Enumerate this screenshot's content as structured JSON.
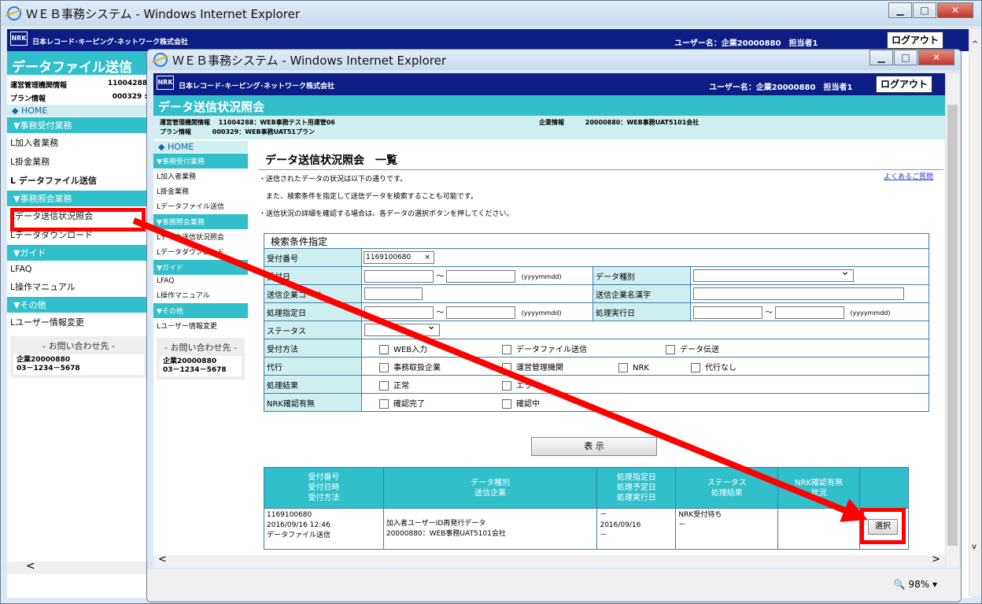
{
  "back_window": {
    "title": "ＷＥＢ事務システム - Windows Internet Explorer",
    "corp": "日本レコード･キーピング･ネットワーク株式会社",
    "user": "ユーザー名：企業20000880　担当者1",
    "logout": "ログアウト",
    "page_title": "データファイル送信",
    "info": [
      {
        "label": "運営管理機関情報",
        "value": "11004288"
      },
      {
        "label": "プラン情報",
        "value": "000329 :"
      }
    ],
    "home": "HOME",
    "nav": [
      {
        "type": "sec",
        "label": "▼事務受付業務"
      },
      {
        "type": "item",
        "label": "L加入者業務"
      },
      {
        "type": "item",
        "label": "L掛金業務"
      },
      {
        "type": "item",
        "label": "L データファイル送信"
      },
      {
        "type": "sec",
        "label": "▼事務照会業務"
      },
      {
        "type": "item",
        "label": "Lデータ送信状況照会"
      },
      {
        "type": "item",
        "label": "Lデータダウンロード"
      },
      {
        "type": "sec",
        "label": "▼ガイド"
      },
      {
        "type": "item",
        "label": "LFAQ"
      },
      {
        "type": "item",
        "label": "L操作マニュアル"
      },
      {
        "type": "sec",
        "label": "▼その他"
      },
      {
        "type": "item",
        "label": "Lユーザー情報変更"
      }
    ],
    "contact_title": "- お問い合わせ先 -",
    "contact_name": "企業20000880",
    "contact_tel": "03－1234－5678"
  },
  "front_window": {
    "title": "ＷＥＢ事務システム - Windows Internet Explorer",
    "corp": "日本レコード･キーピング･ネットワーク株式会社",
    "user": "ユーザー名：企業20000880　担当者1",
    "logout": "ログアウト",
    "page_title": "データ送信状況照会",
    "info": {
      "admin_label": "運営管理機関情報",
      "admin_value": "11004288：WEB事務テスト用運管06",
      "plan_label": "プラン情報",
      "plan_value": "000329：WEB事務UAT51プラン",
      "company_label": "企業情報",
      "company_value": "20000880：WEB事務UAT5101会社"
    },
    "nav": {
      "home": "HOME",
      "items": [
        {
          "type": "sec",
          "label": "▼事務受付業務"
        },
        {
          "type": "item",
          "label": "L加入者業務"
        },
        {
          "type": "item",
          "label": "L掛金業務"
        },
        {
          "type": "item",
          "label": "Lデータファイル送信"
        },
        {
          "type": "sec",
          "label": "▼事務照会業務"
        },
        {
          "type": "item",
          "label": "Lデータ送信状況照会"
        },
        {
          "type": "item",
          "label": "Lデータダウンロード"
        },
        {
          "type": "sec",
          "label": "▼ガイド"
        },
        {
          "type": "item",
          "label": "LFAQ"
        },
        {
          "type": "item",
          "label": "L操作マニュアル"
        },
        {
          "type": "sec",
          "label": "▼その他"
        },
        {
          "type": "item",
          "label": "Lユーザー情報変更"
        }
      ],
      "contact_title": "- お問い合わせ先 -",
      "contact_name": "企業20000880",
      "contact_tel": "03－1234－5678"
    },
    "main": {
      "heading": "データ送信状況照会　一覧",
      "faq_link": "よくあるご質問",
      "notes": [
        "・送信されたデータの状況は以下の通りです。",
        "　また、検索条件を指定して送信データを検索することも可能です。",
        "・送信状況の詳細を確認する場合は、各データの選択ボタンを押してください。"
      ],
      "search": {
        "title": "検索条件指定",
        "receipt_no_label": "受付番号",
        "receipt_no_value": "1169100680",
        "receipt_date_label": "受付日",
        "tilde": "～",
        "date_format": "(yyyymmdd)",
        "data_type_label": "データ種別",
        "sender_code_label": "送信企業コード",
        "sender_name_label": "送信企業名漢字",
        "proc_date_label": "処理指定日",
        "exec_date_label": "処理実行日",
        "status_label": "ステータス",
        "method_label": "受付方法",
        "method_options": [
          "WEB入力",
          "データファイル送信",
          "データ伝送"
        ],
        "agent_label": "代行",
        "agent_options": [
          "事務取扱企業",
          "運営管理機関",
          "NRK",
          "代行なし"
        ],
        "result_label": "処理結果",
        "result_options": [
          "正常",
          "エラー"
        ],
        "nrk_label": "NRK確認有無",
        "nrk_options": [
          "確認完了",
          "確認中"
        ],
        "show_button": "表 示"
      },
      "results": {
        "headers": [
          [
            "受付番号",
            "受付日時",
            "受付方法"
          ],
          [
            "データ種別",
            "送信企業"
          ],
          [
            "処理指定日",
            "処理予定日",
            "処理実行日"
          ],
          [
            "ステータス",
            "処理結果"
          ],
          [
            "NRK確認有無",
            "状況"
          ],
          [
            ""
          ]
        ],
        "rows": [
          {
            "receipt_no": "1169100680",
            "receipt_datetime": "2016/09/16 12:46",
            "method": "データファイル送信",
            "data_type": "加入者ユーザーID再発行データ",
            "sender": "20000880：WEB事務UAT5101会社",
            "proc_date": "－",
            "plan_date": "2016/09/16",
            "exec_date": "－",
            "status": "NRK受付待ち",
            "result": "－",
            "nrk": "",
            "select_button": "選択"
          }
        ]
      }
    },
    "zoom": "98%"
  },
  "colors": {
    "header": "#0c1e86",
    "accent": "#31bfcb",
    "highlight": "#ff0000"
  }
}
